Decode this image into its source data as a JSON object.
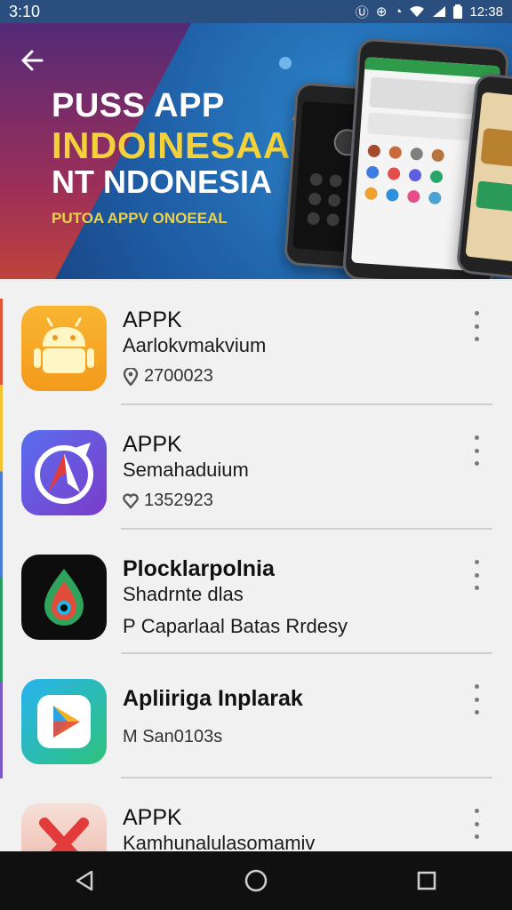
{
  "status_bar": {
    "time": "3:10",
    "clock": "12:38",
    "icons": [
      "sync-icon",
      "data-icon",
      "alarm-icon",
      "wifi-icon",
      "signal-icon",
      "battery-icon"
    ]
  },
  "banner": {
    "back_icon": "arrow-left-icon",
    "line1": "PUSS APP",
    "line2": "INDOINESAA",
    "line3": "NT NDONESIA",
    "tagline": "PUTOA APPV ONOEEAL",
    "colors": {
      "accent_yellow": "#f3d13b",
      "background": "#1f5ea6"
    }
  },
  "apps": [
    {
      "title": "APPK",
      "subtitle": "Aarlokvmakvium",
      "meta_icon": "location-pin-icon",
      "meta": "2700023",
      "icon": "android-icon",
      "icon_bg": "#f6a623"
    },
    {
      "title": "APPK",
      "subtitle": "Semahaduium",
      "meta_icon": "heart-icon",
      "meta": "1352923",
      "icon": "compass-a-icon",
      "icon_bg": "#6b4bd6"
    },
    {
      "title": "Plocklarpolnia",
      "subtitle": "Shadrnte dlas",
      "meta": "Caparlaal Batas Rrdesy",
      "meta_prefix": "P",
      "icon": "drop-pin-icon",
      "icon_bg": "#0d0d0d"
    },
    {
      "title": "Apliiriga Inplarak",
      "subtitle": "",
      "meta": "M San0103s",
      "icon": "play-triangle-icon",
      "icon_bg": "#2aa7e0"
    },
    {
      "title": "APPK",
      "subtitle": "Kamhunalulasomamiv",
      "meta": "",
      "icon": "x-mark-icon",
      "icon_bg": "#f3d6cf"
    }
  ],
  "nav": {
    "back": "back-triangle-icon",
    "home": "home-circle-icon",
    "recents": "recents-square-icon"
  }
}
